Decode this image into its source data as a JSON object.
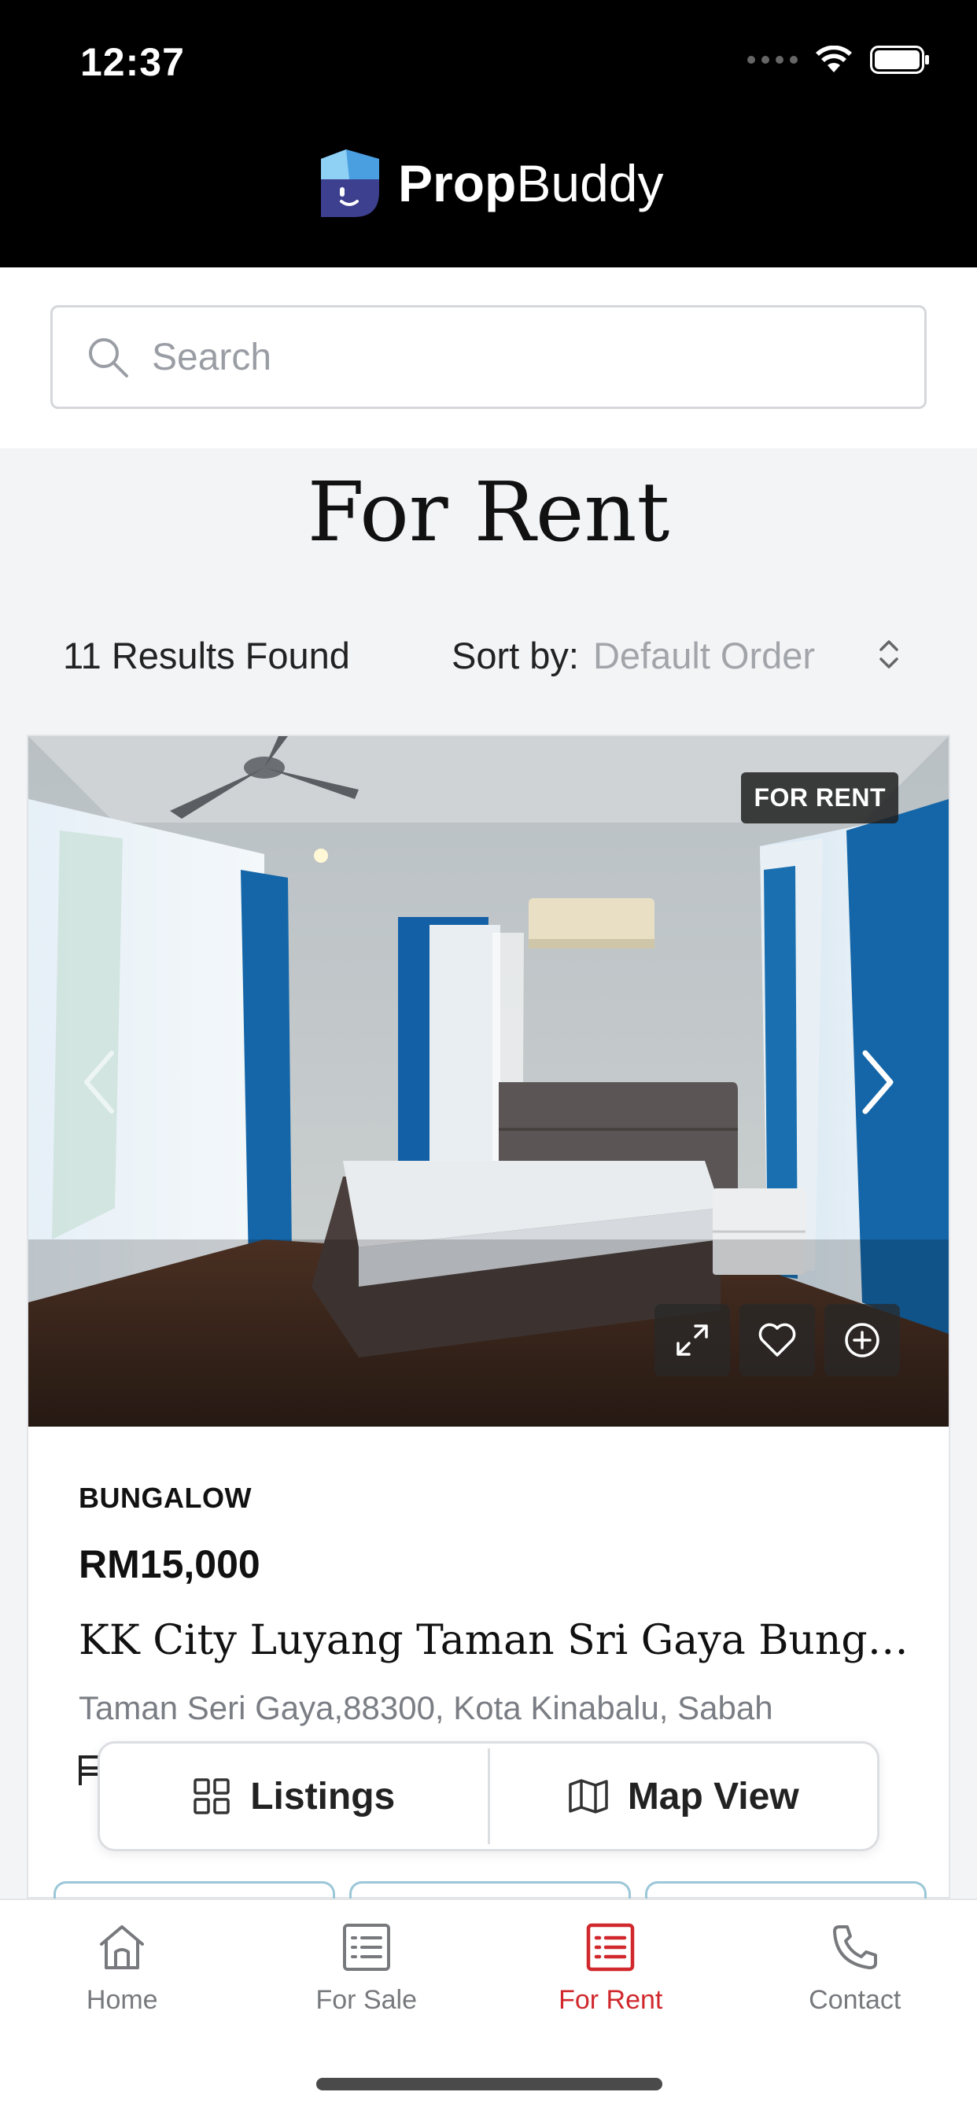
{
  "status_bar": {
    "time": "12:37"
  },
  "header": {
    "brand_bold": "Prop",
    "brand_light": "Buddy"
  },
  "search": {
    "placeholder": "Search",
    "value": ""
  },
  "page": {
    "title": "For Rent"
  },
  "results": {
    "count_text": "11 Results Found",
    "sort_label": "Sort by:",
    "sort_value": "Default Order"
  },
  "listing": {
    "badge": "FOR RENT",
    "type": "BUNGALOW",
    "price": "RM15,000",
    "title": "KK City Luyang Taman Sri Gaya Bunglow ...",
    "address": "Taman Seri Gaya,88300, Kota Kinabalu, Sabah"
  },
  "view_toggle": {
    "listings": "Listings",
    "map_view": "Map View"
  },
  "bottom_nav": {
    "items": [
      {
        "label": "Home",
        "icon": "home-icon"
      },
      {
        "label": "For Sale",
        "icon": "list-icon"
      },
      {
        "label": "For Rent",
        "icon": "list-icon",
        "active": true
      },
      {
        "label": "Contact",
        "icon": "phone-icon"
      }
    ]
  },
  "colors": {
    "accent": "#d0282c",
    "header_bg": "#000000",
    "brand_blue": "#3a7bd5"
  }
}
